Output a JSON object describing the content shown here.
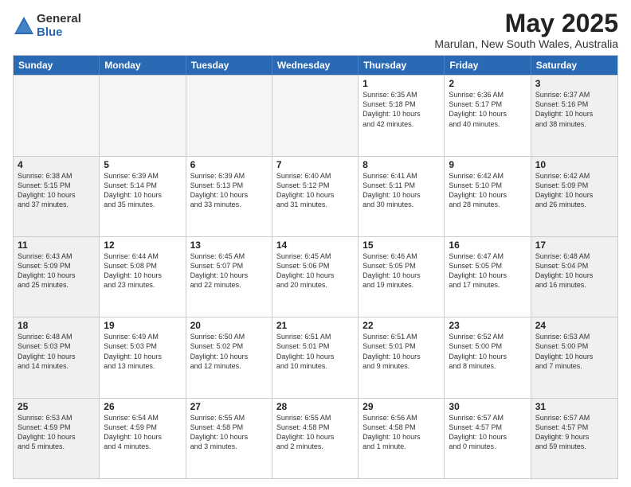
{
  "logo": {
    "general": "General",
    "blue": "Blue"
  },
  "title": "May 2025",
  "subtitle": "Marulan, New South Wales, Australia",
  "headers": [
    "Sunday",
    "Monday",
    "Tuesday",
    "Wednesday",
    "Thursday",
    "Friday",
    "Saturday"
  ],
  "weeks": [
    [
      {
        "day": "",
        "info": ""
      },
      {
        "day": "",
        "info": ""
      },
      {
        "day": "",
        "info": ""
      },
      {
        "day": "",
        "info": ""
      },
      {
        "day": "1",
        "info": "Sunrise: 6:35 AM\nSunset: 5:18 PM\nDaylight: 10 hours\nand 42 minutes."
      },
      {
        "day": "2",
        "info": "Sunrise: 6:36 AM\nSunset: 5:17 PM\nDaylight: 10 hours\nand 40 minutes."
      },
      {
        "day": "3",
        "info": "Sunrise: 6:37 AM\nSunset: 5:16 PM\nDaylight: 10 hours\nand 38 minutes."
      }
    ],
    [
      {
        "day": "4",
        "info": "Sunrise: 6:38 AM\nSunset: 5:15 PM\nDaylight: 10 hours\nand 37 minutes."
      },
      {
        "day": "5",
        "info": "Sunrise: 6:39 AM\nSunset: 5:14 PM\nDaylight: 10 hours\nand 35 minutes."
      },
      {
        "day": "6",
        "info": "Sunrise: 6:39 AM\nSunset: 5:13 PM\nDaylight: 10 hours\nand 33 minutes."
      },
      {
        "day": "7",
        "info": "Sunrise: 6:40 AM\nSunset: 5:12 PM\nDaylight: 10 hours\nand 31 minutes."
      },
      {
        "day": "8",
        "info": "Sunrise: 6:41 AM\nSunset: 5:11 PM\nDaylight: 10 hours\nand 30 minutes."
      },
      {
        "day": "9",
        "info": "Sunrise: 6:42 AM\nSunset: 5:10 PM\nDaylight: 10 hours\nand 28 minutes."
      },
      {
        "day": "10",
        "info": "Sunrise: 6:42 AM\nSunset: 5:09 PM\nDaylight: 10 hours\nand 26 minutes."
      }
    ],
    [
      {
        "day": "11",
        "info": "Sunrise: 6:43 AM\nSunset: 5:09 PM\nDaylight: 10 hours\nand 25 minutes."
      },
      {
        "day": "12",
        "info": "Sunrise: 6:44 AM\nSunset: 5:08 PM\nDaylight: 10 hours\nand 23 minutes."
      },
      {
        "day": "13",
        "info": "Sunrise: 6:45 AM\nSunset: 5:07 PM\nDaylight: 10 hours\nand 22 minutes."
      },
      {
        "day": "14",
        "info": "Sunrise: 6:45 AM\nSunset: 5:06 PM\nDaylight: 10 hours\nand 20 minutes."
      },
      {
        "day": "15",
        "info": "Sunrise: 6:46 AM\nSunset: 5:05 PM\nDaylight: 10 hours\nand 19 minutes."
      },
      {
        "day": "16",
        "info": "Sunrise: 6:47 AM\nSunset: 5:05 PM\nDaylight: 10 hours\nand 17 minutes."
      },
      {
        "day": "17",
        "info": "Sunrise: 6:48 AM\nSunset: 5:04 PM\nDaylight: 10 hours\nand 16 minutes."
      }
    ],
    [
      {
        "day": "18",
        "info": "Sunrise: 6:48 AM\nSunset: 5:03 PM\nDaylight: 10 hours\nand 14 minutes."
      },
      {
        "day": "19",
        "info": "Sunrise: 6:49 AM\nSunset: 5:03 PM\nDaylight: 10 hours\nand 13 minutes."
      },
      {
        "day": "20",
        "info": "Sunrise: 6:50 AM\nSunset: 5:02 PM\nDaylight: 10 hours\nand 12 minutes."
      },
      {
        "day": "21",
        "info": "Sunrise: 6:51 AM\nSunset: 5:01 PM\nDaylight: 10 hours\nand 10 minutes."
      },
      {
        "day": "22",
        "info": "Sunrise: 6:51 AM\nSunset: 5:01 PM\nDaylight: 10 hours\nand 9 minutes."
      },
      {
        "day": "23",
        "info": "Sunrise: 6:52 AM\nSunset: 5:00 PM\nDaylight: 10 hours\nand 8 minutes."
      },
      {
        "day": "24",
        "info": "Sunrise: 6:53 AM\nSunset: 5:00 PM\nDaylight: 10 hours\nand 7 minutes."
      }
    ],
    [
      {
        "day": "25",
        "info": "Sunrise: 6:53 AM\nSunset: 4:59 PM\nDaylight: 10 hours\nand 5 minutes."
      },
      {
        "day": "26",
        "info": "Sunrise: 6:54 AM\nSunset: 4:59 PM\nDaylight: 10 hours\nand 4 minutes."
      },
      {
        "day": "27",
        "info": "Sunrise: 6:55 AM\nSunset: 4:58 PM\nDaylight: 10 hours\nand 3 minutes."
      },
      {
        "day": "28",
        "info": "Sunrise: 6:55 AM\nSunset: 4:58 PM\nDaylight: 10 hours\nand 2 minutes."
      },
      {
        "day": "29",
        "info": "Sunrise: 6:56 AM\nSunset: 4:58 PM\nDaylight: 10 hours\nand 1 minute."
      },
      {
        "day": "30",
        "info": "Sunrise: 6:57 AM\nSunset: 4:57 PM\nDaylight: 10 hours\nand 0 minutes."
      },
      {
        "day": "31",
        "info": "Sunrise: 6:57 AM\nSunset: 4:57 PM\nDaylight: 9 hours\nand 59 minutes."
      }
    ]
  ]
}
